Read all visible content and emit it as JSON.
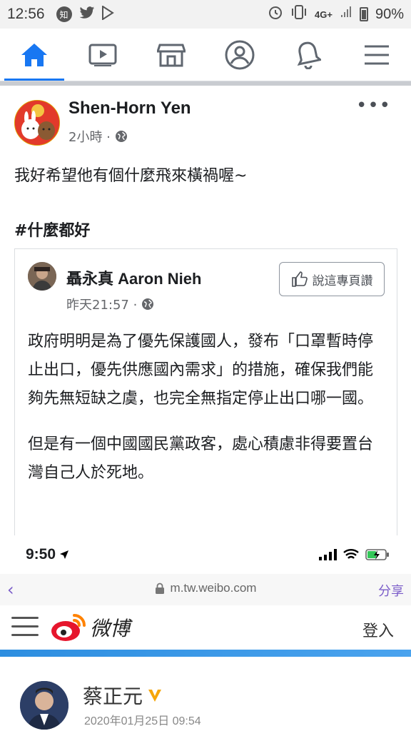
{
  "status_bar": {
    "time": "12:56",
    "zhi_badge": "知",
    "icons": [
      "zhihu-icon",
      "twitter-icon",
      "play-store-icon",
      "alarm-icon",
      "vibrate-icon",
      "4g-signal-icon",
      "battery-icon"
    ],
    "network": "4G+",
    "battery": "90%"
  },
  "fb_nav": {
    "items": [
      "home-icon",
      "watch-icon",
      "marketplace-icon",
      "profile-icon",
      "notifications-icon",
      "menu-icon"
    ],
    "active": "home-icon",
    "accent": "#1877f2"
  },
  "post": {
    "author": "Shen-Horn Yen",
    "time": "2小時 ·",
    "text": "我好希望他有個什麼飛來橫禍喔~",
    "hashtag": "#什麼都好",
    "shared": {
      "author": "聶永真 Aaron Nieh",
      "time": "昨天21:57 ·",
      "like_button": "說這專頁讚",
      "paragraphs": [
        "政府明明是為了優先保護國人，發布「口罩暫時停止出口，優先供應國內需求」的措施，確保我們能夠先無短缺之虞，也完全無指定停止出口哪一國。",
        "但是有一個中國國民黨政客，處心積慮非得要置台灣自己人於死地。"
      ]
    }
  },
  "embedded": {
    "ios_time": "9:50",
    "url": "m.tw.weibo.com",
    "share_label": "分享",
    "weibo_name": "微博",
    "login_label": "登入",
    "user_name": "蔡正元",
    "post_date": "2020年01月25日 09:54",
    "accent": "#7b5dc9"
  }
}
